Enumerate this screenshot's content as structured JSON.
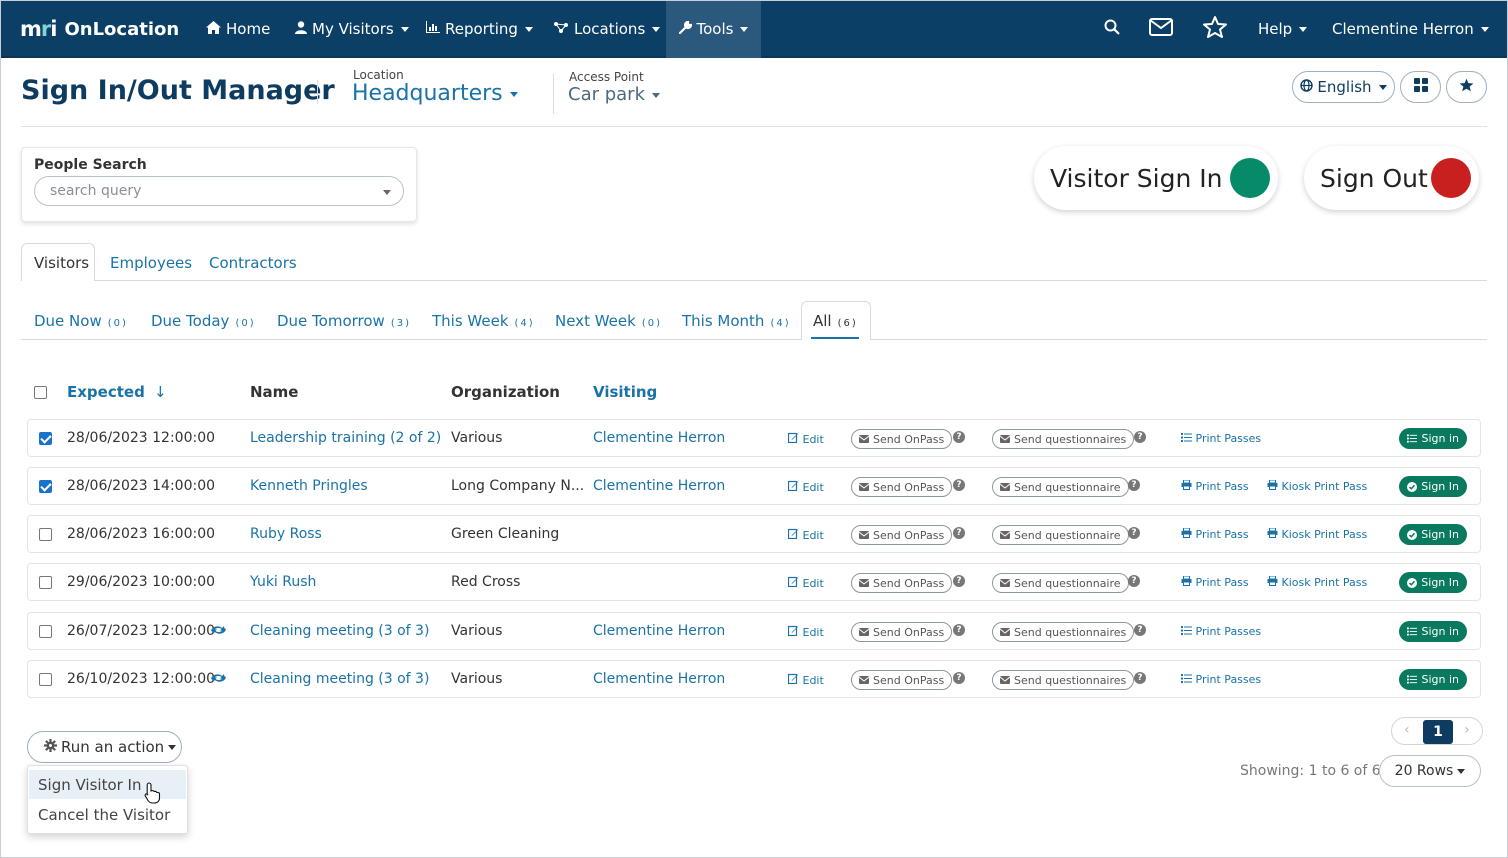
{
  "nav": {
    "brand_mark": "mri",
    "brand_text": "OnLocation",
    "items": [
      {
        "label": "Home",
        "icon": "home-icon"
      },
      {
        "label": "My Visitors",
        "icon": "user-icon"
      },
      {
        "label": "Reporting",
        "icon": "bar-chart-icon"
      },
      {
        "label": "Locations",
        "icon": "network-icon"
      },
      {
        "label": "Tools",
        "icon": "wrench-icon"
      }
    ],
    "help": "Help",
    "user": "Clementine Herron"
  },
  "header": {
    "title": "Sign In/Out Manager",
    "location_label": "Location",
    "location_value": "Headquarters",
    "access_point_label": "Access Point",
    "access_point_value": "Car park",
    "language": "English"
  },
  "search": {
    "label": "People Search",
    "placeholder": "search query"
  },
  "actions": {
    "visitor_sign_in": "Visitor Sign In",
    "sign_out": "Sign Out",
    "sign_in_color": "#078a68",
    "sign_out_color": "#c8201e"
  },
  "type_tabs": [
    "Visitors",
    "Employees",
    "Contractors"
  ],
  "filter_tabs": [
    {
      "label": "Due Now",
      "count": "(0)"
    },
    {
      "label": "Due Today",
      "count": "(0)"
    },
    {
      "label": "Due Tomorrow",
      "count": "(3)"
    },
    {
      "label": "This Week",
      "count": "(4)"
    },
    {
      "label": "Next Week",
      "count": "(0)"
    },
    {
      "label": "This Month",
      "count": "(4)"
    },
    {
      "label": "All",
      "count": "(6)"
    }
  ],
  "table": {
    "columns": [
      "Expected",
      "Name",
      "Organization",
      "Visiting"
    ],
    "sort_indicator": "↓",
    "edit_label": "Edit",
    "onpass_label": "Send OnPass",
    "rows": [
      {
        "checked": true,
        "expected": "28/06/2023 12:00:00",
        "recurring": false,
        "name": "Leadership training (2 of 2)",
        "organization": "Various",
        "visiting": "Clementine Herron",
        "questionnaire": "Send questionnaires",
        "print": "Print Passes",
        "kiosk": "",
        "sign_in": "Sign in"
      },
      {
        "checked": true,
        "expected": "28/06/2023 14:00:00",
        "recurring": false,
        "name": "Kenneth Pringles",
        "organization": "Long Company N...",
        "visiting": "Clementine Herron",
        "questionnaire": "Send questionnaire",
        "print": "Print Pass",
        "kiosk": "Kiosk Print Pass",
        "sign_in": "Sign In"
      },
      {
        "checked": false,
        "expected": "28/06/2023 16:00:00",
        "recurring": false,
        "name": "Ruby Ross",
        "organization": "Green Cleaning",
        "visiting": "",
        "questionnaire": "Send questionnaire",
        "print": "Print Pass",
        "kiosk": "Kiosk Print Pass",
        "sign_in": "Sign In"
      },
      {
        "checked": false,
        "expected": "29/06/2023 10:00:00",
        "recurring": false,
        "name": "Yuki Rush",
        "organization": "Red Cross",
        "visiting": "",
        "questionnaire": "Send questionnaire",
        "print": "Print Pass",
        "kiosk": "Kiosk Print Pass",
        "sign_in": "Sign In"
      },
      {
        "checked": false,
        "expected": "26/07/2023 12:00:00",
        "recurring": true,
        "name": "Cleaning meeting (3 of 3)",
        "organization": "Various",
        "visiting": "Clementine Herron",
        "questionnaire": "Send questionnaires",
        "print": "Print Passes",
        "kiosk": "",
        "sign_in": "Sign in"
      },
      {
        "checked": false,
        "expected": "26/10/2023 12:00:00",
        "recurring": true,
        "name": "Cleaning meeting (3 of 3)",
        "organization": "Various",
        "visiting": "Clementine Herron",
        "questionnaire": "Send questionnaires",
        "print": "Print Passes",
        "kiosk": "",
        "sign_in": "Sign in"
      }
    ]
  },
  "bottom": {
    "run_action": "Run an action",
    "menu_items": [
      "Sign Visitor In",
      "Cancel the Visitor"
    ],
    "page": "1",
    "showing": "Showing: 1 to 6 of 6",
    "rows_per_page": "20 Rows"
  }
}
